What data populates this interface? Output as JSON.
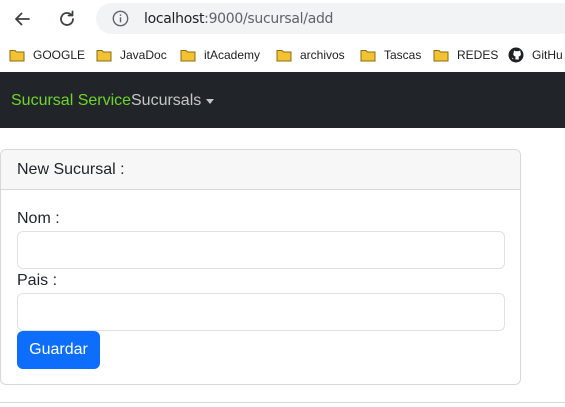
{
  "browser": {
    "url_host": "localhost",
    "url_path": ":9000/sucursal/add",
    "icons": {
      "back": "arrow-left-icon",
      "reload": "reload-icon",
      "info": "info-icon",
      "folder": "folder-icon",
      "github": "github-icon"
    },
    "bookmarks": [
      {
        "label": "GOOGLE"
      },
      {
        "label": "JavaDoc"
      },
      {
        "label": "itAcademy"
      },
      {
        "label": "archivos"
      },
      {
        "label": "Tascas"
      },
      {
        "label": "REDES"
      },
      {
        "label": "GitHu"
      }
    ]
  },
  "navbar": {
    "brand": "Sucursal Service",
    "dropdown_label": "Sucursals"
  },
  "form": {
    "header": "New Sucursal :",
    "nom_label": "Nom :",
    "nom_value": "",
    "pais_label": "Pais :",
    "pais_value": "",
    "submit_label": "Guardar"
  },
  "colors": {
    "navbar_bg": "#212529",
    "brand": "#6dd629",
    "primary_button": "#0d6efd",
    "folder": "#f2c233"
  }
}
